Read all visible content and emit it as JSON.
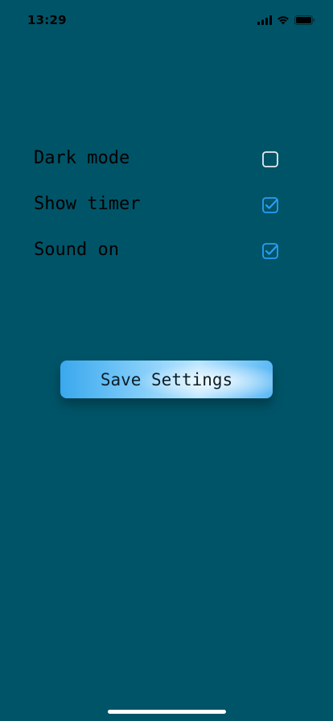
{
  "status_bar": {
    "time": "13:29",
    "icons": [
      "cellular-signal-icon",
      "wifi-icon",
      "battery-icon"
    ]
  },
  "settings": [
    {
      "label": "Dark mode",
      "checked": false
    },
    {
      "label": "Show timer",
      "checked": true
    },
    {
      "label": "Sound on",
      "checked": true
    }
  ],
  "save_button": {
    "label": "Save Settings"
  },
  "colors": {
    "background": "#005468",
    "checkbox_checked": "#2a9df4",
    "checkbox_unchecked": "#e6edf0",
    "button_gradient": [
      "#3aa8ee",
      "#bde6ff",
      "#5ab8f5"
    ]
  }
}
